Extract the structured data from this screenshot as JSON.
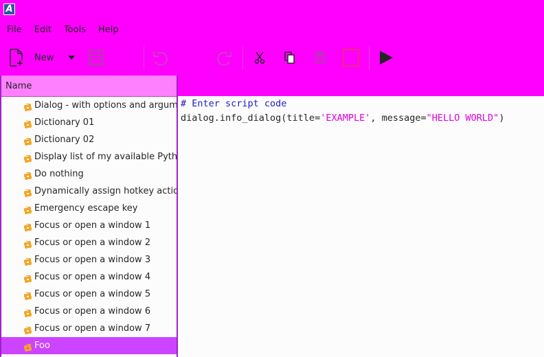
{
  "app": {
    "icon_letter": "A"
  },
  "menubar": {
    "items": [
      "File",
      "Edit",
      "Tools",
      "Help"
    ]
  },
  "toolbar": {
    "new_label": "New",
    "buttons": [
      "new-file-icon",
      "dropdown-arrow-icon",
      "save-icon",
      "undo-icon",
      "redo-icon",
      "cut-icon",
      "copy-icon",
      "paste-icon",
      "delete-icon",
      "run-icon"
    ]
  },
  "sidebar": {
    "header": "Name",
    "items": [
      "Dialog - with options and argumen",
      "Dictionary 01",
      "Dictionary 02",
      "Display list of my available Python",
      "Do nothing",
      "Dynamically assign hotkey actions",
      "Emergency escape key",
      "Focus or open a window 1",
      "Focus or open a window 2",
      "Focus or open a window 3",
      "Focus or open a window 4",
      "Focus or open a window 5",
      "Focus or open a window 6",
      "Focus or open a window 7",
      "Foo"
    ],
    "selected": "Foo"
  },
  "editor": {
    "line1": "# Enter script code",
    "line2_a": "dialog.info_dialog(title=",
    "line2_b": "'EXAMPLE'",
    "line2_c": ", message=",
    "line2_d": "\"HELLO WORLD\"",
    "line2_e": ")"
  },
  "colors": {
    "accent": "#ff00ff",
    "header": "#ff80ff",
    "selection": "#cc44ff",
    "border": "#a020c8"
  }
}
